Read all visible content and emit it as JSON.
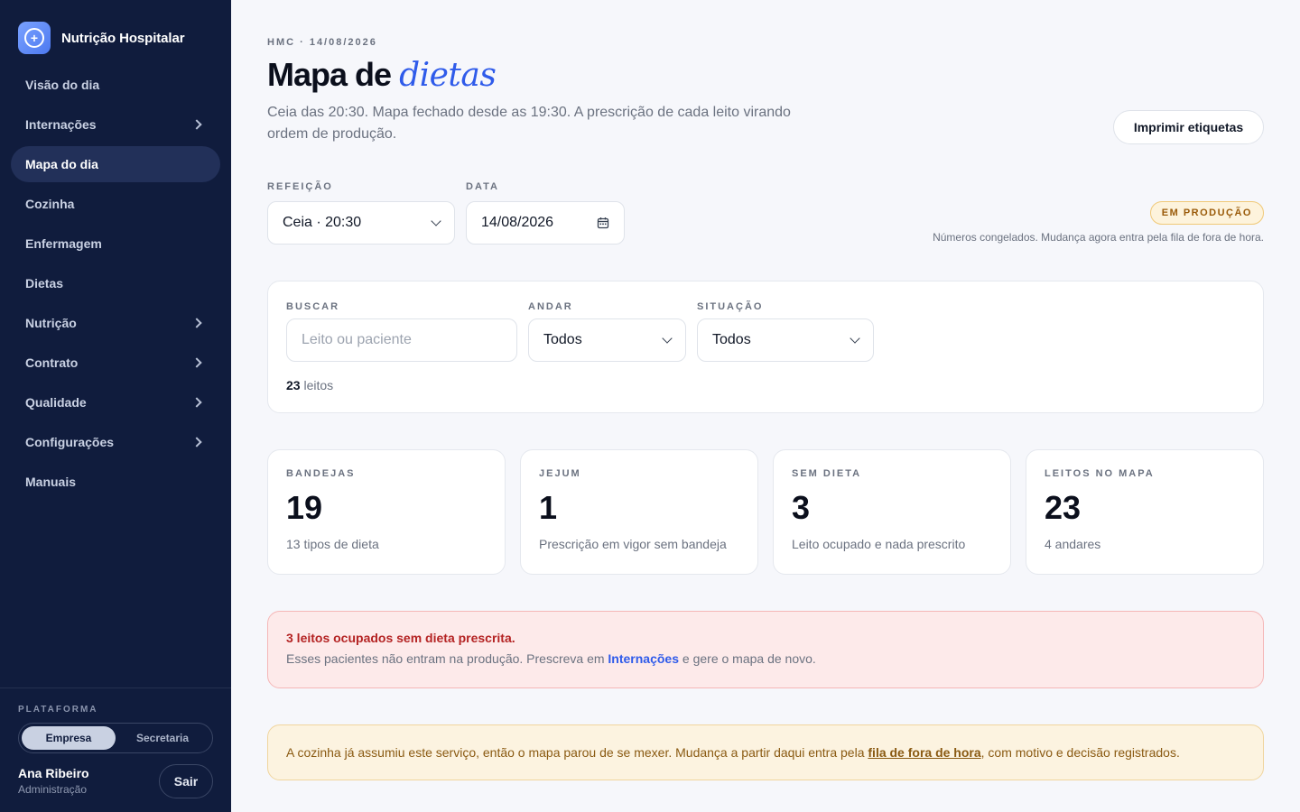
{
  "sidebar": {
    "brand": "Nutrição Hospitalar",
    "items": [
      {
        "label": "Visão do dia"
      },
      {
        "label": "Internações"
      },
      {
        "label": "Mapa do dia"
      },
      {
        "label": "Cozinha"
      },
      {
        "label": "Enfermagem"
      },
      {
        "label": "Dietas"
      },
      {
        "label": "Nutrição"
      },
      {
        "label": "Contrato"
      },
      {
        "label": "Qualidade"
      },
      {
        "label": "Configurações"
      },
      {
        "label": "Manuais"
      }
    ],
    "platform_label": "PLATAFORMA",
    "platform_options": [
      "Empresa",
      "Secretaria"
    ],
    "platform_selected": "Empresa",
    "user": {
      "name": "Ana Ribeiro",
      "role": "Administração"
    },
    "logout_label": "Sair"
  },
  "header": {
    "eyebrow": "HMC · 14/08/2026",
    "title_prefix": "Mapa de",
    "title_emphasis": "dietas",
    "subtitle": "Ceia das 20:30. Mapa fechado desde as 19:30. A prescrição de cada leito virando ordem de produção.",
    "print_button": "Imprimir etiquetas"
  },
  "selectors": {
    "meal_label": "REFEIÇÃO",
    "meal_value": "Ceia · 20:30",
    "date_label": "DATA",
    "date_value": "14/08/2026"
  },
  "status": {
    "badge": "EM PRODUÇÃO",
    "note": "Números congelados. Mudança agora entra pela fila de fora de hora.",
    "badge_color": "#fdf3dc"
  },
  "filters": {
    "search_label": "BUSCAR",
    "search_placeholder": "Leito ou paciente",
    "floor_label": "ANDAR",
    "floor_value": "Todos",
    "situation_label": "SITUAÇÃO",
    "situation_value": "Todos",
    "count_number": "23",
    "count_text": "leitos"
  },
  "stats": [
    {
      "label": "BANDEJAS",
      "value": "19",
      "desc": "13 tipos de dieta"
    },
    {
      "label": "JEJUM",
      "value": "1",
      "desc": "Prescrição em vigor sem bandeja"
    },
    {
      "label": "SEM DIETA",
      "value": "3",
      "desc": "Leito ocupado e nada prescrito"
    },
    {
      "label": "LEITOS NO MAPA",
      "value": "23",
      "desc": "4 andares"
    }
  ],
  "alerts": {
    "red_title": "3 leitos ocupados sem dieta prescrita.",
    "red_body_before": "Esses pacientes não entram na produção. Prescreva em",
    "red_link": "Internações",
    "red_body_after": "e gere o mapa de novo.",
    "yellow_before": "A cozinha já assumiu este serviço, então o mapa parou de se mexer. Mudança a partir daqui entra pela",
    "yellow_link": "fila de fora de hora",
    "yellow_after": ", com motivo e decisão registrados."
  },
  "colors": {
    "sidebar_bg": "#101c3d",
    "accent": "#2f5bea",
    "danger": "#b42323",
    "warning": "#8a5a12"
  }
}
